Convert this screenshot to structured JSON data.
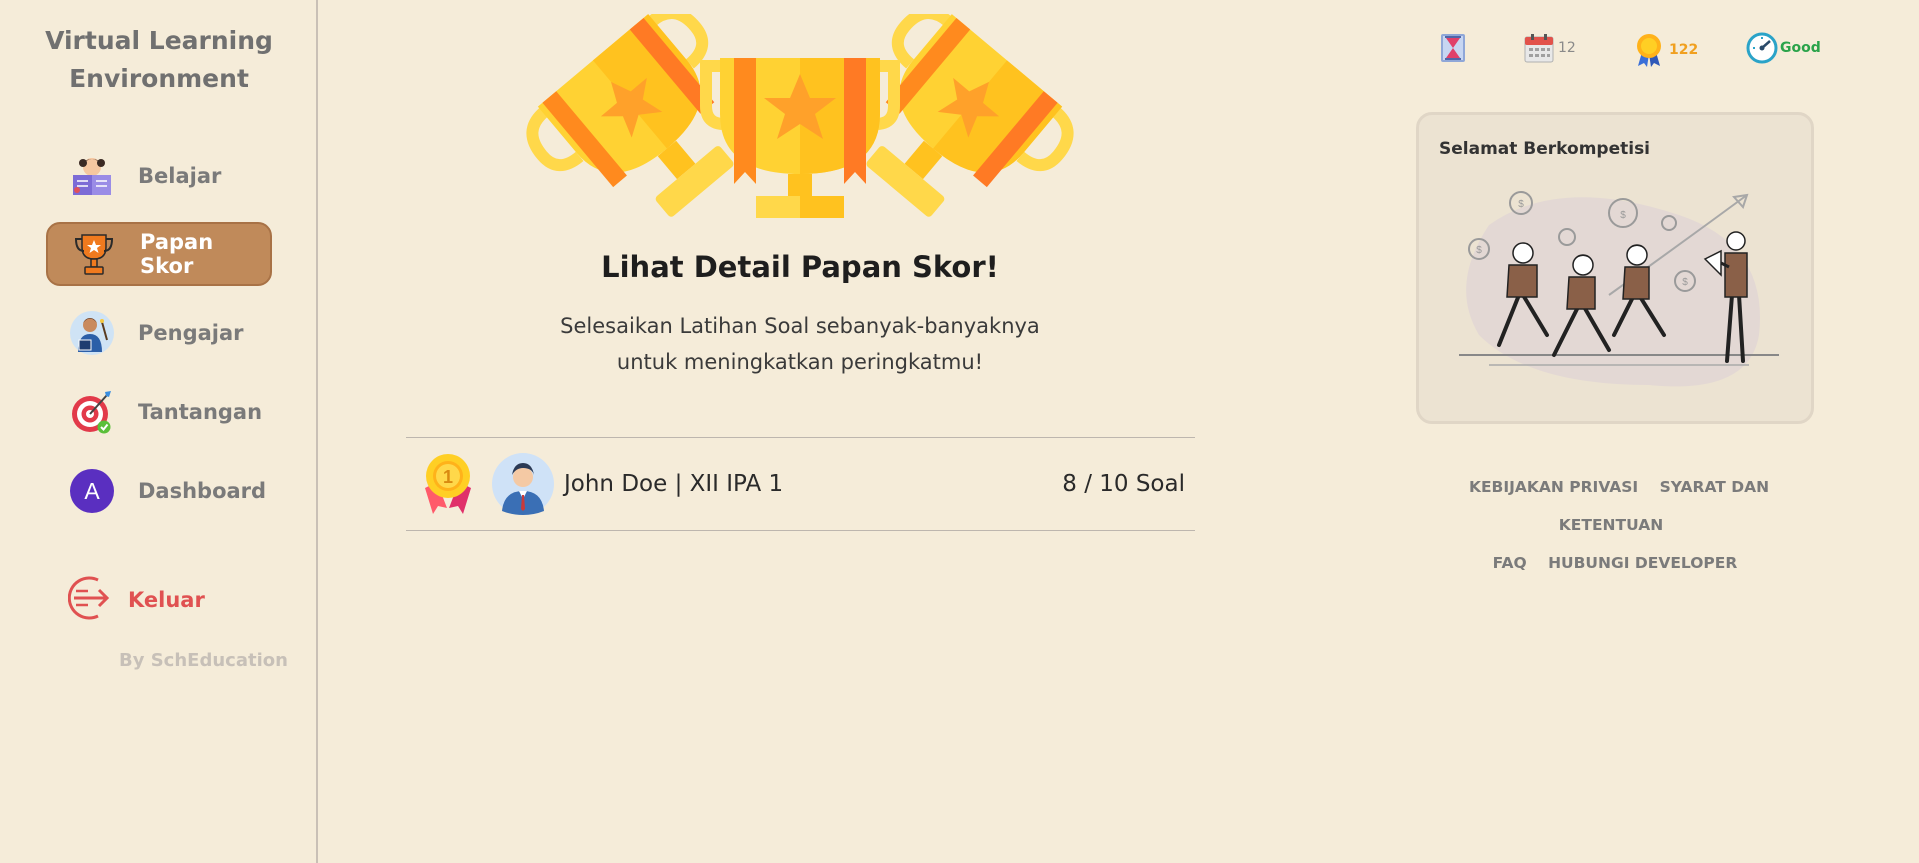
{
  "sidebar": {
    "brand_line1": "Virtual Learning",
    "brand_line2": "Environment",
    "items": [
      {
        "label": "Belajar"
      },
      {
        "label": "Papan Skor"
      },
      {
        "label": "Pengajar"
      },
      {
        "label": "Tantangan"
      },
      {
        "label": "Dashboard",
        "avatar_letter": "A"
      }
    ],
    "logout_label": "Keluar",
    "byline": "By SchEducation"
  },
  "main": {
    "title": "Lihat Detail Papan Skor!",
    "subtitle_line1": "Selesaikan Latihan Soal sebanyak-banyaknya",
    "subtitle_line2": "untuk meningkatkan peringkatmu!",
    "leaderboard": [
      {
        "rank": "1",
        "name": "John Doe | XII IPA 1",
        "score": "8 / 10 Soal"
      }
    ]
  },
  "status": {
    "calendar_count": "12",
    "medal_points": "122",
    "performance": "Good",
    "colors": {
      "calendar": "#8a8a8a",
      "medal": "#f0a020",
      "performance": "#2aa34a"
    }
  },
  "promo": {
    "title": "Selamat Berkompetisi"
  },
  "footer": {
    "privacy": "KEBIJAKAN PRIVASI",
    "terms": "SYARAT DAN KETENTUAN",
    "faq": "FAQ",
    "contact": "HUBUNGI DEVELOPER"
  },
  "colors": {
    "background": "#f5ecd9",
    "active_nav": "#c08a5a",
    "logout": "#e05151"
  }
}
